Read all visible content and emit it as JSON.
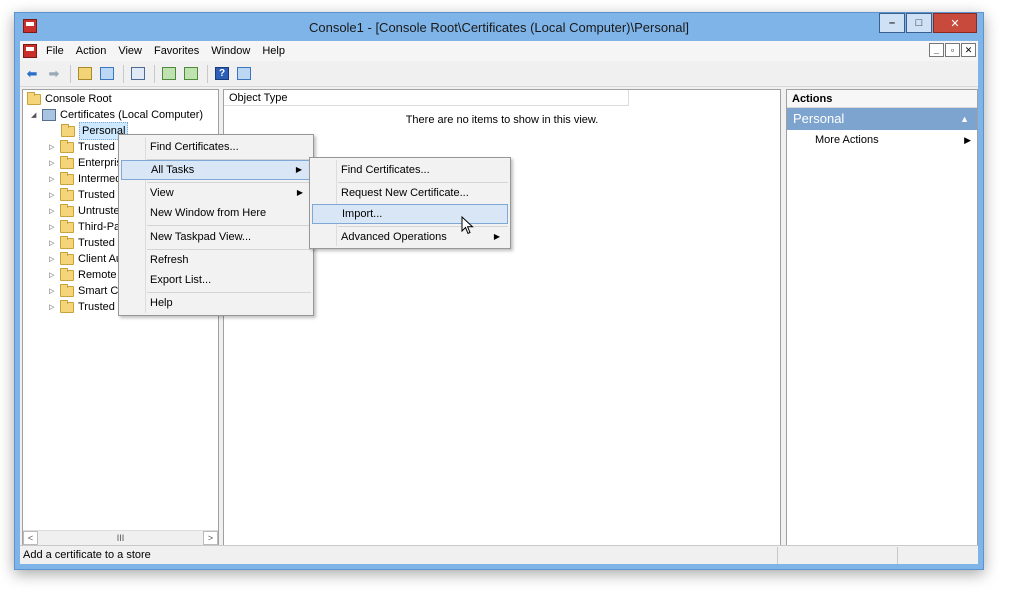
{
  "window": {
    "title": "Console1 - [Console Root\\Certificates (Local Computer)\\Personal]",
    "controls": {
      "minimize": "–",
      "maximize": "□",
      "close": "✕"
    }
  },
  "menubar": {
    "items": [
      "File",
      "Action",
      "View",
      "Favorites",
      "Window",
      "Help"
    ],
    "mdi_controls": {
      "minimize": "_",
      "restore": "▫",
      "close": "✕"
    }
  },
  "toolbar": {
    "buttons": [
      "back-icon",
      "forward-icon",
      "up-folder-icon",
      "show-hide-tree-icon",
      "properties-icon",
      "refresh-icon",
      "export-list-icon",
      "help-icon",
      "show-hide-action-pane-icon"
    ]
  },
  "tree": {
    "root": "Console Root",
    "certificates": "Certificates (Local Computer)",
    "items": [
      {
        "label": "Personal",
        "selected": true
      },
      {
        "label": "Trusted R"
      },
      {
        "label": "Enterpris"
      },
      {
        "label": "Intermed"
      },
      {
        "label": "Trusted P"
      },
      {
        "label": "Untruste"
      },
      {
        "label": "Third-Pa"
      },
      {
        "label": "Trusted P"
      },
      {
        "label": "Client Au"
      },
      {
        "label": "Remote"
      },
      {
        "label": "Smart Ca"
      },
      {
        "label": "Trusted D"
      }
    ],
    "scroll_thumb": "III"
  },
  "center": {
    "column_header": "Object Type",
    "empty_message": "There are no items to show in this view."
  },
  "actions": {
    "title": "Actions",
    "group": "Personal",
    "items": [
      "More Actions"
    ]
  },
  "context_menu": {
    "items": [
      "Find Certificates...",
      "All Tasks",
      "View",
      "New Window from Here",
      "New Taskpad View...",
      "Refresh",
      "Export List...",
      "Help"
    ]
  },
  "submenu": {
    "items": [
      "Find Certificates...",
      "Request New Certificate...",
      "Import...",
      "Advanced Operations"
    ]
  },
  "status": {
    "text": "Add a certificate to a store"
  },
  "colors": {
    "frame": "#7fb4e8",
    "highlight": "#d8e6f6",
    "actions_group": "#7da3cf"
  }
}
